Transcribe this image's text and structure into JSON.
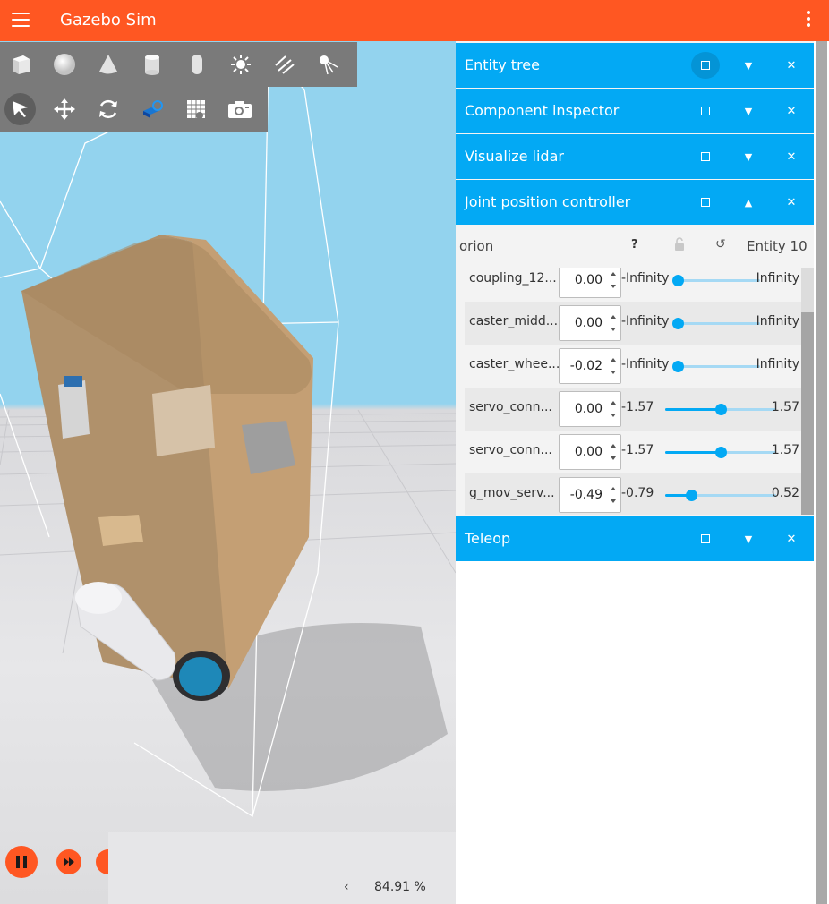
{
  "app": {
    "title": "Gazebo Sim",
    "menu_icon": "hamburger-menu-icon",
    "overflow_icon": "vertical-dots-icon",
    "accent_color": "#ff5722",
    "panel_color": "#03a9f4"
  },
  "toolbar": {
    "shapes": [
      "box-icon",
      "sphere-icon",
      "cone-icon",
      "cylinder-icon",
      "capsule-icon",
      "point-light-icon",
      "directional-light-icon",
      "spot-light-icon"
    ],
    "transform": [
      "select-arrow-icon",
      "translate-icon",
      "rotate-icon",
      "view-angle-icon",
      "grid-snap-icon",
      "screenshot-icon"
    ]
  },
  "panels": [
    {
      "title": "Entity tree",
      "state": "collapsed"
    },
    {
      "title": "Component inspector",
      "state": "collapsed"
    },
    {
      "title": "Visualize lidar",
      "state": "collapsed"
    },
    {
      "title": "Joint position controller",
      "state": "expanded"
    },
    {
      "title": "Teleop",
      "state": "collapsed"
    }
  ],
  "joint_controller": {
    "model": "orion",
    "help": "?",
    "entity": "Entity 10",
    "joints": [
      {
        "name": "coupling_12...",
        "value": "0.00",
        "min": "-Infinity",
        "max": "Infinity",
        "fraction": 0.0
      },
      {
        "name": "caster_midd...",
        "value": "0.00",
        "min": "-Infinity",
        "max": "Infinity",
        "fraction": 0.0
      },
      {
        "name": "caster_whee...",
        "value": "-0.02",
        "min": "-Infinity",
        "max": "Infinity",
        "fraction": 0.0
      },
      {
        "name": "servo_conn...",
        "value": "0.00",
        "min": "-1.57",
        "max": "1.57",
        "fraction": 0.5
      },
      {
        "name": "servo_conn...",
        "value": "0.00",
        "min": "-1.57",
        "max": "1.57",
        "fraction": 0.5
      },
      {
        "name": "g_mov_serv...",
        "value": "-0.49",
        "min": "-0.79",
        "max": "0.52",
        "fraction": 0.23
      }
    ]
  },
  "playback": {
    "play_icon": "pause-icon",
    "step_icon": "fast-forward-icon",
    "rtf_arrow": "‹",
    "rtf": "84.91 %"
  }
}
